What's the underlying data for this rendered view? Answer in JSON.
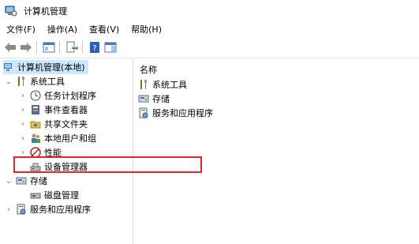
{
  "window": {
    "title": "计算机管理"
  },
  "menu": [
    "文件(F)",
    "操作(A)",
    "查看(V)",
    "帮助(H)"
  ],
  "tree": {
    "root": "计算机管理(本地)",
    "system_tools": "系统工具",
    "task_scheduler": "任务计划程序",
    "event_viewer": "事件查看器",
    "shared_folders": "共享文件夹",
    "local_users": "本地用户和组",
    "performance": "性能",
    "device_manager": "设备管理器",
    "storage": "存储",
    "disk_management": "磁盘管理",
    "services_apps": "服务和应用程序"
  },
  "list": {
    "header": "名称",
    "items": [
      "系统工具",
      "存储",
      "服务和应用程序"
    ]
  },
  "colors": {
    "selection": "#cce8ff",
    "highlight_box": "#e0262b"
  }
}
